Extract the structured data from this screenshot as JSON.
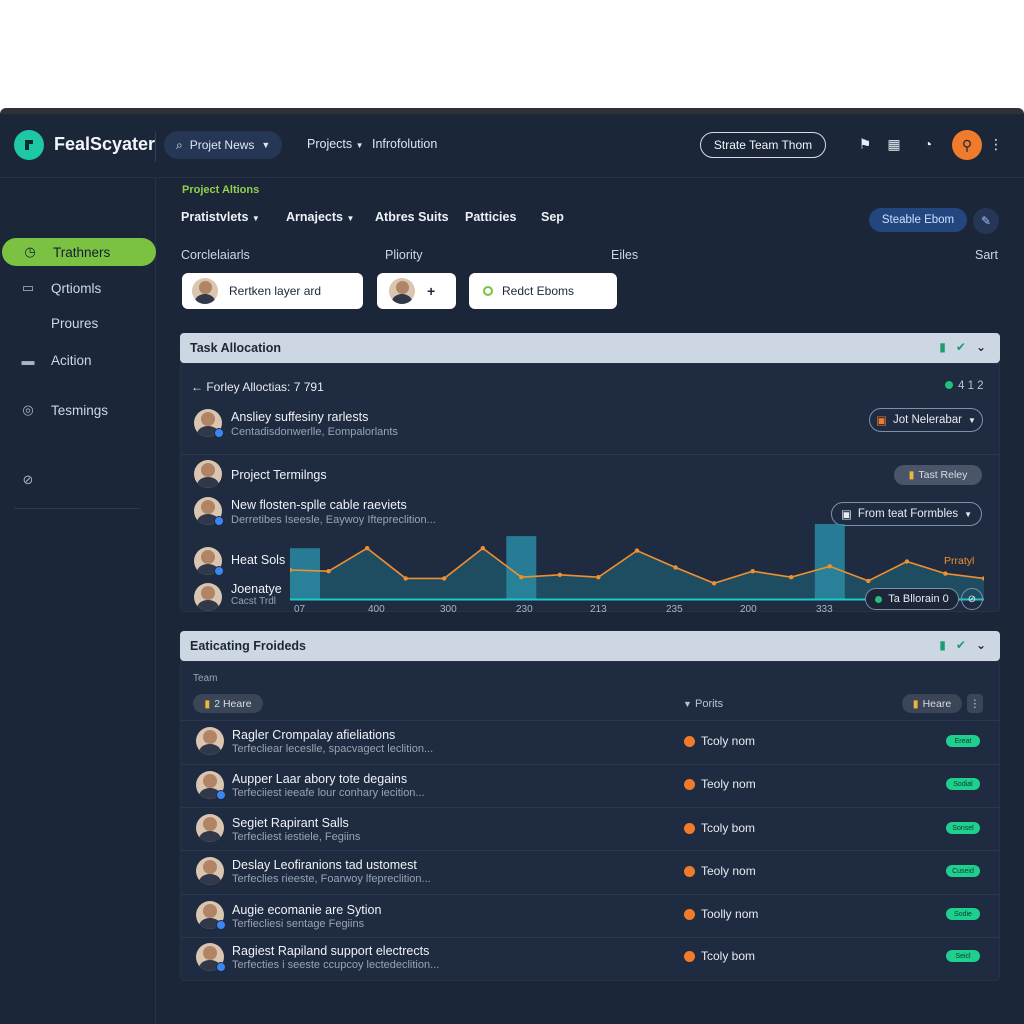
{
  "topbar": {
    "brand": "FealScyater",
    "project_pill": "Projet News",
    "links": [
      "Projects",
      "Infrofolution"
    ],
    "team_button": "Strate Team Thom"
  },
  "sidebar": {
    "items": [
      {
        "label": "Trathners",
        "icon": "clock-icon",
        "active": true
      },
      {
        "label": "Qrtiomls",
        "icon": "chat-icon"
      },
      {
        "label": "Proures",
        "icon": ""
      },
      {
        "label": "Acition",
        "icon": "folder-icon"
      },
      {
        "label": "Tesmings",
        "icon": "help-icon"
      }
    ]
  },
  "header": {
    "section_label": "Project Altions",
    "tabs": [
      "Pratistvlets",
      "Arnajects",
      "Atbres Suits",
      "Patticies",
      "Sep"
    ],
    "blue_button": "Steable Ebom",
    "columns": [
      "Corclelaiarls",
      "Pliority",
      "Eiles",
      "Sart"
    ],
    "chips": [
      "Rertken layer ard",
      "+",
      "Redct Eboms"
    ]
  },
  "task_panel": {
    "title": "Task Allocation",
    "sub_header": "Forley Alloctias: 7 791",
    "counter": "4 1 2",
    "rows": [
      {
        "title": "Ansliey suffesiny rarlests",
        "sub": "Centadisdonwerlle, Eompalorlants",
        "action": "Jot Nelerabar"
      },
      {
        "title": "Project Termilngs",
        "sub": "",
        "action": "Tast Reley"
      },
      {
        "title": "New flosten-splle cable raeviets",
        "sub": "Derretibes Iseesle, Eaywoy Iftepreclition...",
        "action": "From teat Formbles"
      },
      {
        "title": "Heat Sols",
        "sub": "",
        "action": ""
      },
      {
        "title": "Joenatye",
        "sub": "Cacst Trdl",
        "action": ""
      }
    ],
    "chart_legend": "Prratyl",
    "allocate_button": "Ta Bllorain 0",
    "x_ticks": [
      "07",
      "400",
      "300",
      "230",
      "213",
      "235",
      "200",
      "333"
    ]
  },
  "chart_data": {
    "type": "line",
    "x": [
      "07",
      "400",
      "300",
      "230",
      "213",
      "235",
      "200",
      "333"
    ],
    "series": [
      {
        "name": "Prratyl",
        "values": [
          24,
          23,
          42,
          17,
          17,
          42,
          18,
          20,
          18,
          40,
          26,
          13,
          23,
          18,
          27,
          15,
          31,
          21,
          17
        ]
      }
    ],
    "bars": [
      {
        "position": 0,
        "height": 42
      },
      {
        "position": 6,
        "height": 52
      },
      {
        "position": 14,
        "height": 62
      }
    ]
  },
  "estimating_panel": {
    "title": "Eaticating Froideds",
    "col_team": "Team",
    "filter_pill": "2 Heare",
    "col_ports": "Porits",
    "right_pill": "Heare",
    "rows": [
      {
        "title": "Ragler Crompalay afieliations",
        "sub": "Terfecliear leceslle, spacvagect leclition...",
        "status": "Tcoly nom",
        "badge": "Ereat"
      },
      {
        "title": "Aupper Laar abory tote degains",
        "sub": "Terfeciiest ieeafe lour conhary iecition...",
        "status": "Teoly nom",
        "badge": "Sodial"
      },
      {
        "title": "Segiet Rapirant Salls",
        "sub": "Terfecliest iestiele, Fegiins",
        "status": "Tcoly bom",
        "badge": "Sonsel"
      },
      {
        "title": "Deslay Leofiranions tad ustomest",
        "sub": "Terfeclies rieeste, Foarwoy lfepreclition...",
        "status": "Teoly nom",
        "badge": "Cuseid"
      },
      {
        "title": "Augie ecomanie are Sytion",
        "sub": "Terfiecliesi sentage Fegiins",
        "status": "Toolly nom",
        "badge": "Sodie"
      },
      {
        "title": "Ragiest Rapiland support electrects",
        "sub": "Terfecties i seeste ccupcoy lectedeclition...",
        "status": "Tcoly bom",
        "badge": "Seicl"
      }
    ]
  }
}
